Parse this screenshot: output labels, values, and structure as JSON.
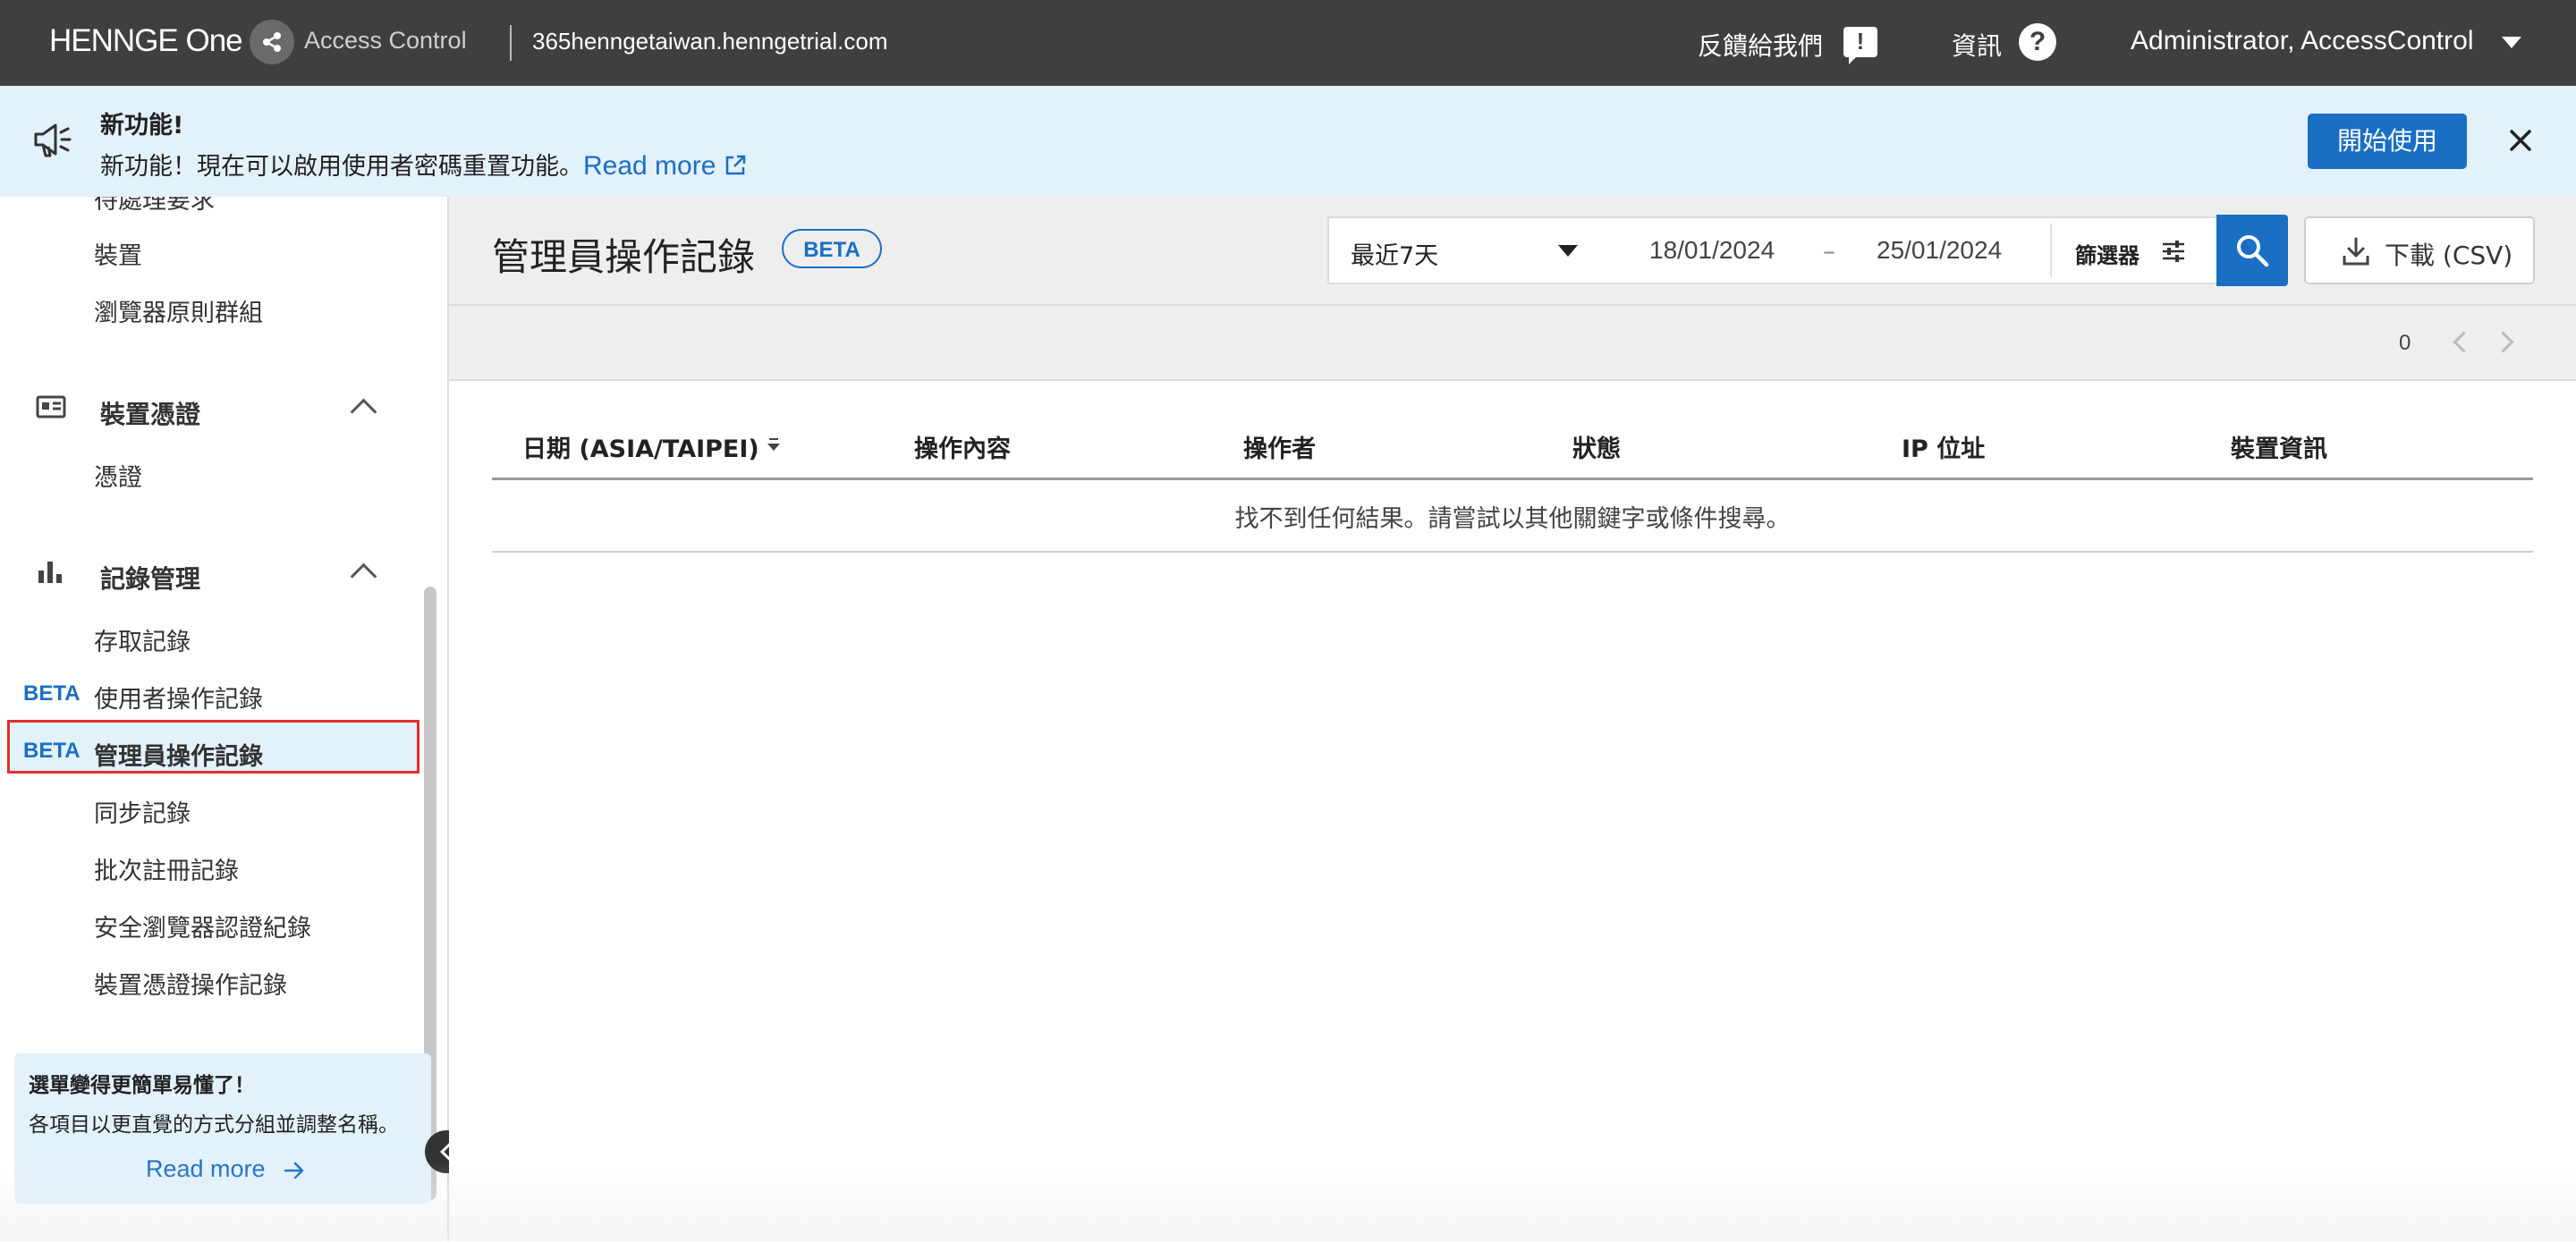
{
  "topbar": {
    "logo_brand": "HENNGE One",
    "logo_product": "Access Control",
    "domain": "365henngetaiwan.henngetrial.com",
    "feedback_label": "反饋給我們",
    "feedback_icon": "!",
    "info_label": "資訊",
    "info_icon": "?",
    "user_name": "Administrator, AccessControl"
  },
  "banner": {
    "title": "新功能!",
    "text": "新功能！現在可以啟用使用者密碼重置功能。",
    "link": "Read more",
    "start_button": "開始使用"
  },
  "sidebar": {
    "partial_item": "待處理要求",
    "items_top": [
      "裝置",
      "瀏覽器原則群組"
    ],
    "group_device_cert": "裝置憑證",
    "device_cert_items": [
      "憑證"
    ],
    "group_logs": "記錄管理",
    "log_items": [
      {
        "label": "存取記錄",
        "beta": ""
      },
      {
        "label": "使用者操作記錄",
        "beta": "BETA"
      },
      {
        "label": "管理員操作記錄",
        "beta": "BETA"
      },
      {
        "label": "同步記錄",
        "beta": ""
      },
      {
        "label": "批次註冊記錄",
        "beta": ""
      },
      {
        "label": "安全瀏覽器認證紀錄",
        "beta": ""
      },
      {
        "label": "裝置憑證操作記錄",
        "beta": ""
      }
    ],
    "tip": {
      "title": "選單變得更簡單易懂了！",
      "text": "各項目以更直覺的方式分組並調整名稱。",
      "link": "Read more"
    }
  },
  "main": {
    "title": "管理員操作記錄",
    "beta_badge": "BETA",
    "filter": {
      "range": "最近7天",
      "date_from": "18/01/2024",
      "date_sep": "–",
      "date_to": "25/01/2024",
      "filter_label": "篩選器"
    },
    "download_label": "下載 (CSV)",
    "pager_count": "0",
    "table": {
      "columns": [
        "日期 (ASIA/TAIPEI)",
        "操作內容",
        "操作者",
        "狀態",
        "IP 位址",
        "裝置資訊"
      ],
      "empty_message": "找不到任何結果。請嘗試以其他關鍵字或條件搜尋。"
    }
  },
  "colors": {
    "topbar": "#3f3f3f",
    "accent": "#1a6fc4",
    "banner_bg": "#e3f1fb",
    "highlight_border": "#e0302a"
  }
}
